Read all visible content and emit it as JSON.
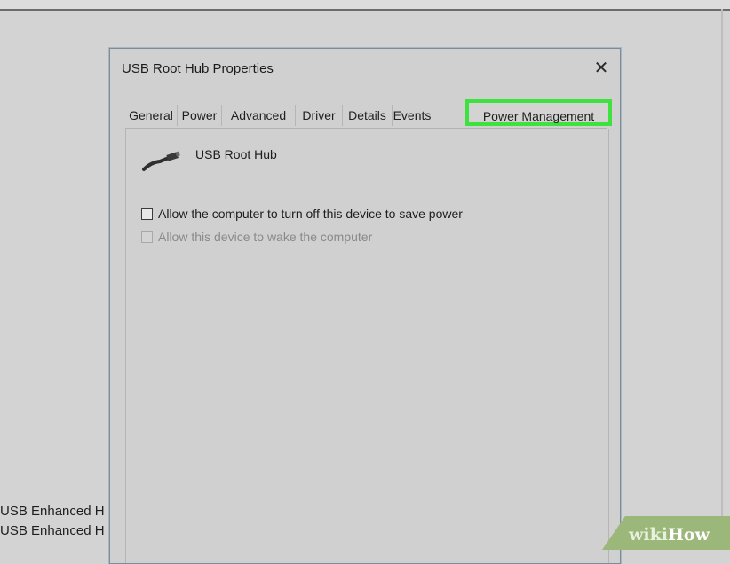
{
  "background": {
    "list_items": [
      "USB Enhanced H",
      "USB Enhanced H"
    ]
  },
  "dialog": {
    "title": "USB Root Hub Properties",
    "close_glyph": "✕",
    "tabs": [
      {
        "label": "General"
      },
      {
        "label": "Power"
      },
      {
        "label": "Advanced"
      },
      {
        "label": "Driver"
      },
      {
        "label": "Details"
      },
      {
        "label": "Events"
      },
      {
        "label": "Power Management",
        "active": true
      }
    ],
    "device": {
      "icon": "usb-cable-icon",
      "name": "USB Root Hub"
    },
    "options": [
      {
        "label": "Allow the computer to turn off this device to save power",
        "checked": false,
        "enabled": true
      },
      {
        "label": "Allow this device to wake the computer",
        "checked": false,
        "enabled": false
      }
    ]
  },
  "watermark": {
    "part1": "wiki",
    "part2": "How"
  },
  "colors": {
    "highlight": "#3ee13e",
    "window_bg": "#d0d0d0"
  }
}
